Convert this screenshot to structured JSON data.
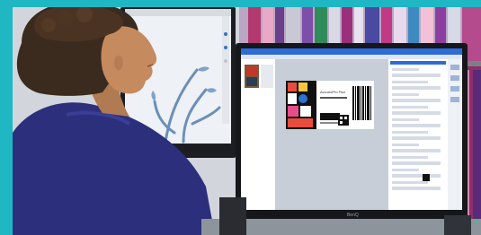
{
  "scene": {
    "brand_accent": "#1fb7c4",
    "app_accent": "#2f6bd8",
    "label_text_line1": "AccurioPro Flux",
    "monitor_brand": "BenQ"
  },
  "icons": {
    "barcode": "barcode-icon",
    "qr": "qr-code-icon"
  }
}
